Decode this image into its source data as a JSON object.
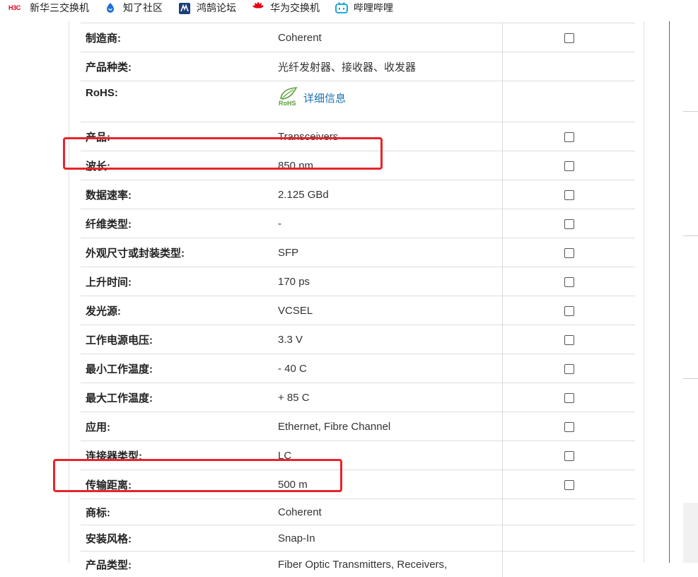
{
  "bookmarks": [
    {
      "label": "新华三交换机",
      "icon": "h3c-logo-icon",
      "icon_text": "H3C"
    },
    {
      "label": "知了社区",
      "icon": "zhiliao-icon"
    },
    {
      "label": "鸿鹄论坛",
      "icon": "honghu-icon"
    },
    {
      "label": "华为交换机",
      "icon": "huawei-logo-icon"
    },
    {
      "label": "哔哩哔哩",
      "icon": "bilibili-icon"
    }
  ],
  "specs": [
    {
      "label": "制造商:",
      "value": "Coherent"
    },
    {
      "label": "产品种类:",
      "value": "光纤发射器、接收器、收发器"
    },
    {
      "label": "RoHS:",
      "value": "详细信息",
      "rohs_badge": "RoHS"
    },
    {
      "label": "产品:",
      "value": "Transceivers"
    },
    {
      "label": "波长:",
      "value": "850 nm"
    },
    {
      "label": "数据速率:",
      "value": "2.125 GBd"
    },
    {
      "label": "纤维类型:",
      "value": "-"
    },
    {
      "label": "外观尺寸或封装类型:",
      "value": "SFP"
    },
    {
      "label": "上升时间:",
      "value": "170 ps"
    },
    {
      "label": "发光源:",
      "value": "VCSEL"
    },
    {
      "label": "工作电源电压:",
      "value": "3.3 V"
    },
    {
      "label": "最小工作温度:",
      "value": "- 40 C"
    },
    {
      "label": "最大工作温度:",
      "value": "+ 85 C"
    },
    {
      "label": "应用:",
      "value": "Ethernet, Fibre Channel"
    },
    {
      "label": "连接器类型:",
      "value": "LC"
    },
    {
      "label": "传输距离:",
      "value": "500 m"
    },
    {
      "label": "商标:",
      "value": "Coherent"
    },
    {
      "label": "安装风格:",
      "value": "Snap-In"
    },
    {
      "label": "产品类型:",
      "value": "Fiber Optic Transmitters, Receivers,"
    }
  ],
  "colors": {
    "highlight": "#e8242a",
    "link": "#1a6fb0",
    "rohs_green": "#5a9e3a"
  }
}
